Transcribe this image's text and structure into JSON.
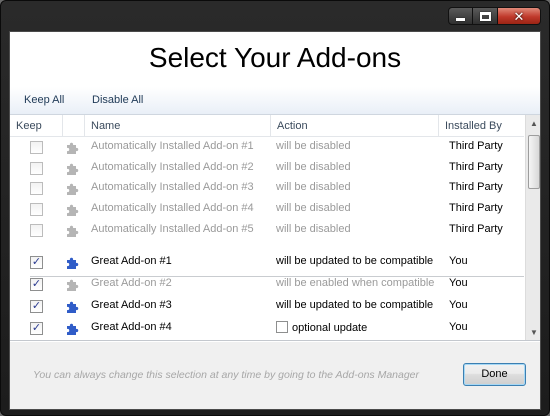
{
  "window": {
    "title": "Select Your Add-ons"
  },
  "toolbar": {
    "keep_all": "Keep All",
    "disable_all": "Disable All"
  },
  "columns": {
    "keep": "Keep",
    "name": "Name",
    "action": "Action",
    "installed_by": "Installed By"
  },
  "addons": [
    {
      "keep": false,
      "enabled": false,
      "name": "Automatically Installed Add-on #1",
      "action": "will be disabled",
      "installed_by": "Third Party",
      "icon": "puzzle-piece-gray"
    },
    {
      "keep": false,
      "enabled": false,
      "name": "Automatically Installed Add-on #2",
      "action": "will be disabled",
      "installed_by": "Third Party",
      "icon": "puzzle-piece-gray"
    },
    {
      "keep": false,
      "enabled": false,
      "name": "Automatically Installed Add-on #3",
      "action": "will be disabled",
      "installed_by": "Third Party",
      "icon": "puzzle-piece-gray"
    },
    {
      "keep": false,
      "enabled": false,
      "name": "Automatically Installed Add-on #4",
      "action": "will be disabled",
      "installed_by": "Third Party",
      "icon": "puzzle-piece-gray"
    },
    {
      "keep": false,
      "enabled": false,
      "name": "Automatically Installed Add-on #5",
      "action": "will be disabled",
      "installed_by": "Third Party",
      "icon": "puzzle-piece-gray"
    },
    {
      "keep": true,
      "enabled": true,
      "name": "Great Add-on #1",
      "action": "will be updated to be compatible",
      "installed_by": "You",
      "icon": "puzzle-piece-blue"
    },
    {
      "keep": true,
      "enabled": false,
      "name": "Great Add-on #2",
      "action": "will be enabled when compatible",
      "installed_by": "You",
      "icon": "puzzle-piece-gray"
    },
    {
      "keep": true,
      "enabled": true,
      "name": "Great Add-on #3",
      "action": "will be updated to be compatible",
      "installed_by": "You",
      "icon": "puzzle-piece-blue"
    },
    {
      "keep": true,
      "enabled": true,
      "name": "Great Add-on #4",
      "action": "optional update",
      "action_checkbox": false,
      "installed_by": "You",
      "icon": "puzzle-piece-blue"
    }
  ],
  "footer": {
    "note": "You can always change this selection at any time by going to the Add-ons Manager",
    "done": "Done"
  },
  "colors": {
    "accent_blue": "#2f5cc8",
    "icon_gray": "#b5b5b5",
    "dim_text": "#9a9a9a"
  }
}
